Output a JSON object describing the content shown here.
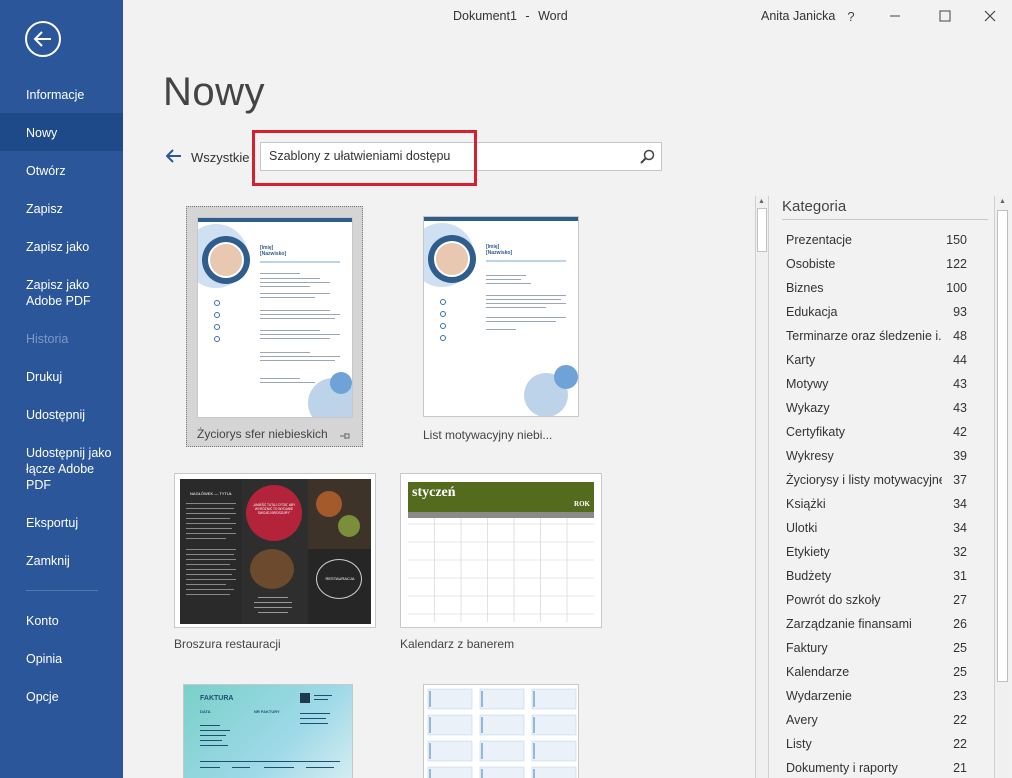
{
  "titlebar": {
    "document": "Dokument1",
    "separator": "-",
    "app": "Word",
    "user": "Anita Janicka",
    "help": "?"
  },
  "nav": {
    "items": [
      {
        "label": "Informacje"
      },
      {
        "label": "Nowy"
      },
      {
        "label": "Otwórz"
      },
      {
        "label": "Zapisz"
      },
      {
        "label": "Zapisz jako"
      },
      {
        "label": "Zapisz jako\nAdobe PDF"
      },
      {
        "label": "Historia"
      },
      {
        "label": "Drukuj"
      },
      {
        "label": "Udostępnij"
      },
      {
        "label": "Udostępnij jako\nłącze Adobe\nPDF"
      },
      {
        "label": "Eksportuj"
      },
      {
        "label": "Zamknij"
      },
      {
        "label": "Konto"
      },
      {
        "label": "Opinia"
      },
      {
        "label": "Opcje"
      }
    ]
  },
  "main": {
    "title": "Nowy",
    "all_label": "Wszystkie",
    "search_value": "Szablony z ułatwieniami dostępu"
  },
  "templates": [
    {
      "label": "Życiorys sfer niebieskich"
    },
    {
      "label": "List motywacyjny niebi..."
    },
    {
      "label": "Broszura restauracji"
    },
    {
      "label": "Kalendarz z banerem"
    }
  ],
  "thumb_text": {
    "resume_name": "[Imię]",
    "resume_surname": "[Nazwisko]",
    "brochure_heading": "NAGŁÓWEK — TYTUŁ",
    "brochure_quote": "„UMIEŚĆ TUTAJ CYTAT, ABY WYRÓŻNIĆ TO WYDANIE SWOJEJ BROSZURY”",
    "brochure_badge": "RESTAURACJA",
    "calendar_month": "styczeń",
    "calendar_year": "ROK",
    "invoice_title": "FAKTURA",
    "invoice_date": "DATA",
    "invoice_no": "NR FAKTURY"
  },
  "categories": {
    "title": "Kategoria",
    "items": [
      {
        "name": "Prezentacje",
        "count": "150"
      },
      {
        "name": "Osobiste",
        "count": "122"
      },
      {
        "name": "Biznes",
        "count": "100"
      },
      {
        "name": "Edukacja",
        "count": "93"
      },
      {
        "name": "Terminarze oraz śledzenie i...",
        "count": "48"
      },
      {
        "name": "Karty",
        "count": "44"
      },
      {
        "name": "Motywy",
        "count": "43"
      },
      {
        "name": "Wykazy",
        "count": "43"
      },
      {
        "name": "Certyfikaty",
        "count": "42"
      },
      {
        "name": "Wykresy",
        "count": "39"
      },
      {
        "name": "Życiorysy i listy motywacyjne",
        "count": "37"
      },
      {
        "name": "Książki",
        "count": "34"
      },
      {
        "name": "Ulotki",
        "count": "34"
      },
      {
        "name": "Etykiety",
        "count": "32"
      },
      {
        "name": "Budżety",
        "count": "31"
      },
      {
        "name": "Powrót do szkoły",
        "count": "27"
      },
      {
        "name": "Zarządzanie finansami",
        "count": "26"
      },
      {
        "name": "Faktury",
        "count": "25"
      },
      {
        "name": "Kalendarze",
        "count": "25"
      },
      {
        "name": "Wydarzenie",
        "count": "23"
      },
      {
        "name": "Avery",
        "count": "22"
      },
      {
        "name": "Listy",
        "count": "22"
      },
      {
        "name": "Dokumenty i raporty",
        "count": "21"
      }
    ]
  },
  "colors": {
    "nav_bg": "#2b579a",
    "nav_active": "#1f4a8a",
    "highlight": "#d6202f"
  }
}
